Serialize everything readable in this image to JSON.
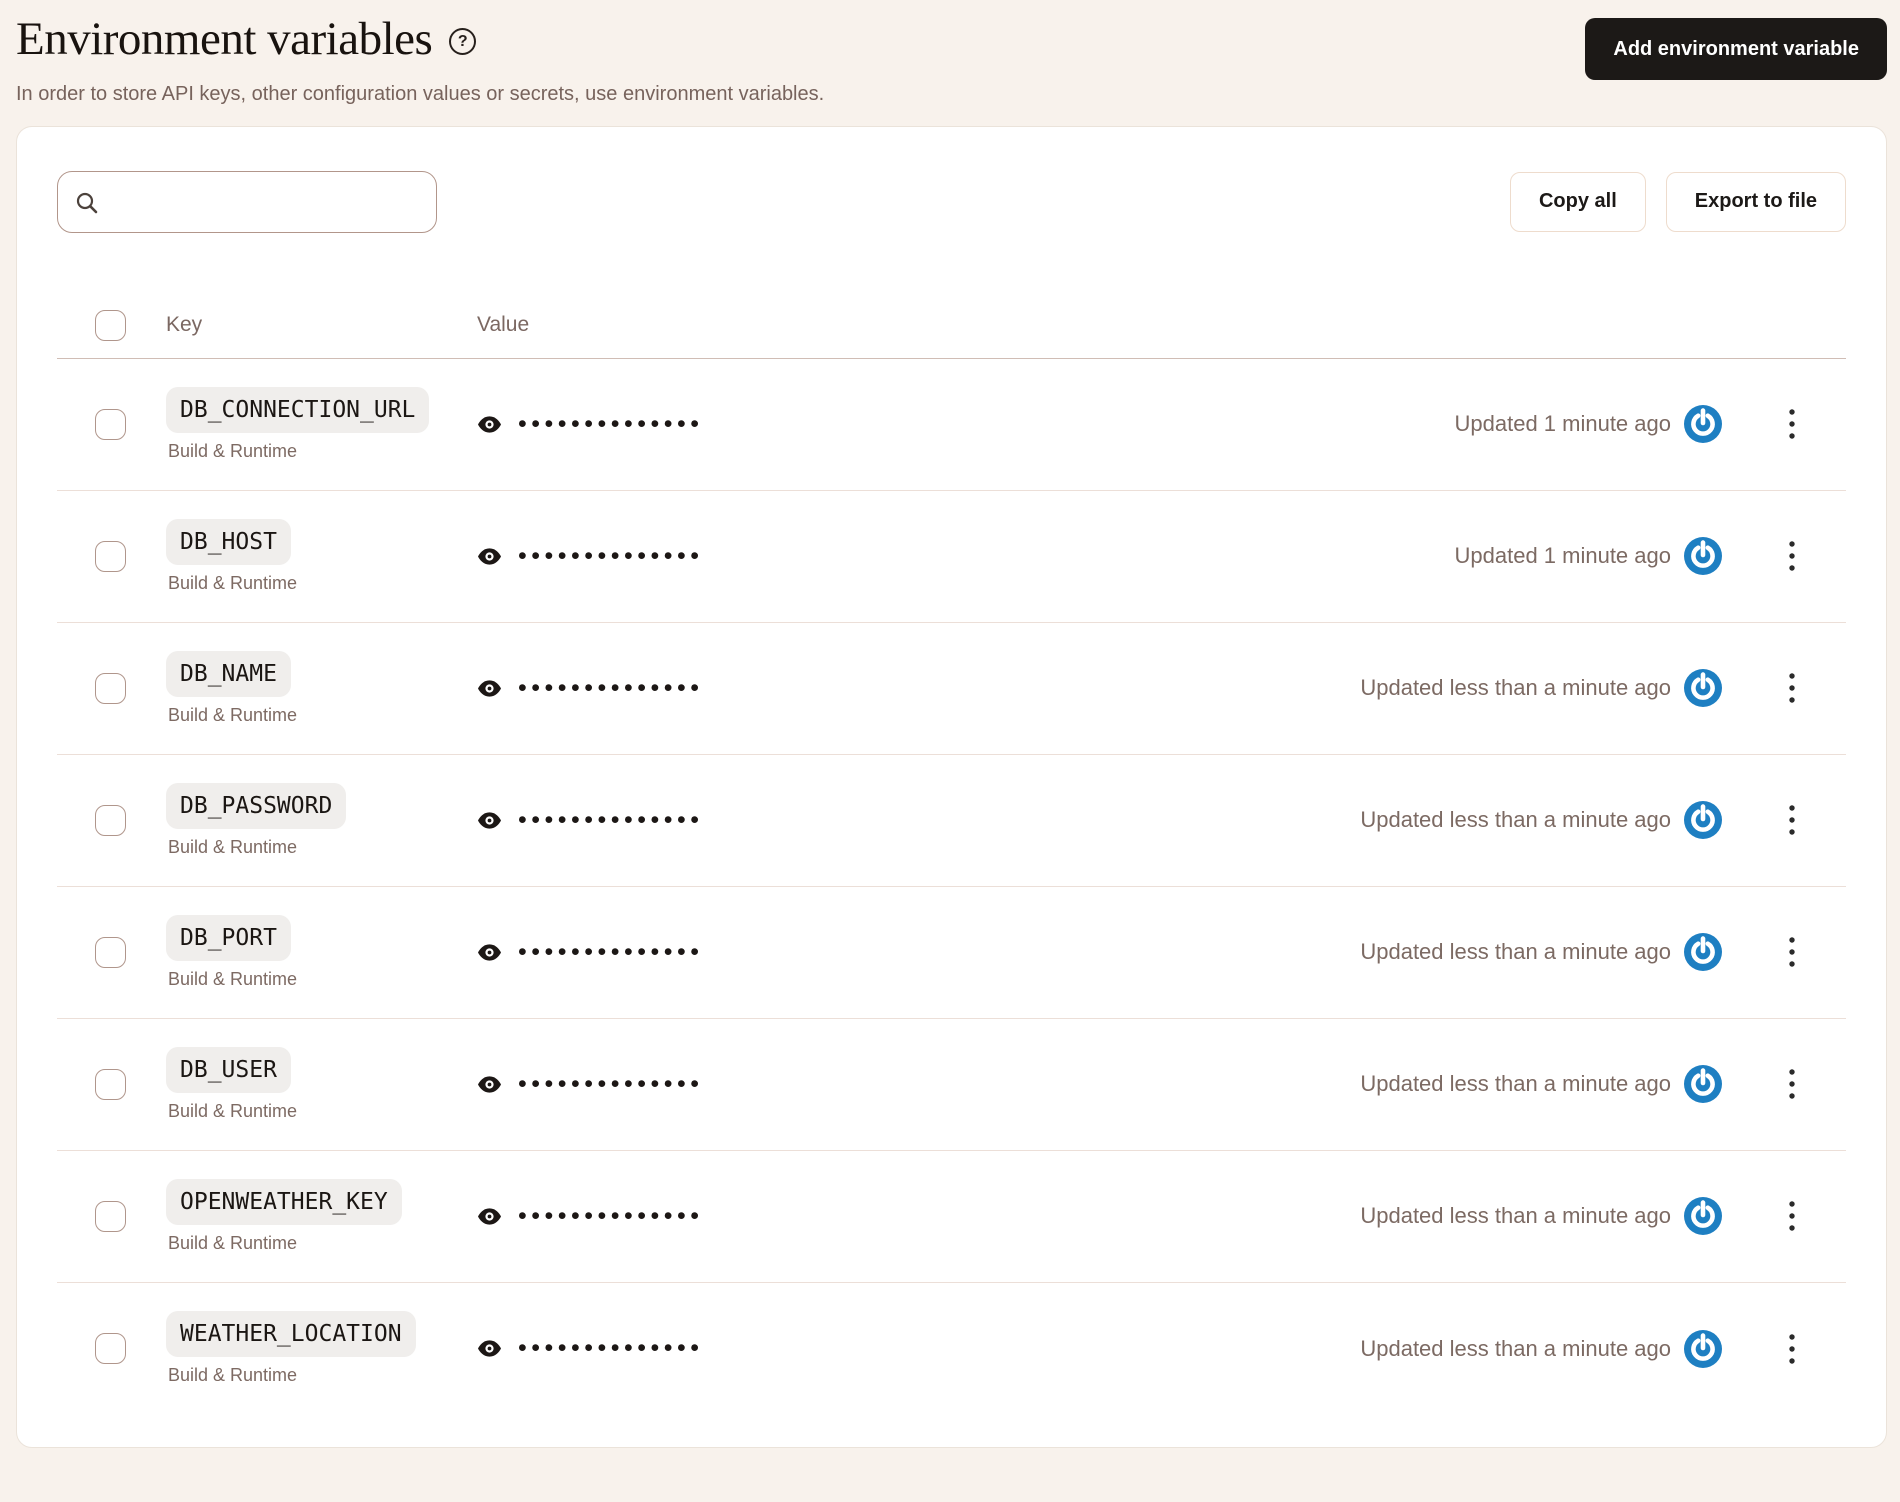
{
  "page": {
    "title": "Environment variables",
    "help_glyph": "?",
    "subtitle": "In order to store API keys, other configuration values or secrets, use environment variables.",
    "add_button_label": "Add environment variable"
  },
  "toolbar": {
    "search_value": "",
    "search_placeholder": "",
    "copy_all_label": "Copy all",
    "export_label": "Export to file"
  },
  "table": {
    "columns": {
      "key": "Key",
      "value": "Value"
    },
    "masked_value": "••••••••••••••",
    "rows": [
      {
        "key": "DB_CONNECTION_URL",
        "scope": "Build & Runtime",
        "updated": "Updated 1 minute ago"
      },
      {
        "key": "DB_HOST",
        "scope": "Build & Runtime",
        "updated": "Updated 1 minute ago"
      },
      {
        "key": "DB_NAME",
        "scope": "Build & Runtime",
        "updated": "Updated less than a minute ago"
      },
      {
        "key": "DB_PASSWORD",
        "scope": "Build & Runtime",
        "updated": "Updated less than a minute ago"
      },
      {
        "key": "DB_PORT",
        "scope": "Build & Runtime",
        "updated": "Updated less than a minute ago"
      },
      {
        "key": "DB_USER",
        "scope": "Build & Runtime",
        "updated": "Updated less than a minute ago"
      },
      {
        "key": "OPENWEATHER_KEY",
        "scope": "Build & Runtime",
        "updated": "Updated less than a minute ago"
      },
      {
        "key": "WEATHER_LOCATION",
        "scope": "Build & Runtime",
        "updated": "Updated less than a minute ago"
      }
    ]
  },
  "icons": {
    "help": "help-icon",
    "search": "search-icon",
    "eye": "reveal-value-eye-icon",
    "status": "restart-status-icon",
    "menu": "kebab-menu-icon"
  },
  "colors": {
    "page_bg": "#f8f2ec",
    "card_bg": "#ffffff",
    "dark_button": "#1c1917",
    "muted_text": "#7c6a63",
    "pill_bg": "#f0eeec",
    "status_blue": "#1e7fc2",
    "search_border": "#b2968b",
    "row_divider": "#ecdfd8"
  }
}
